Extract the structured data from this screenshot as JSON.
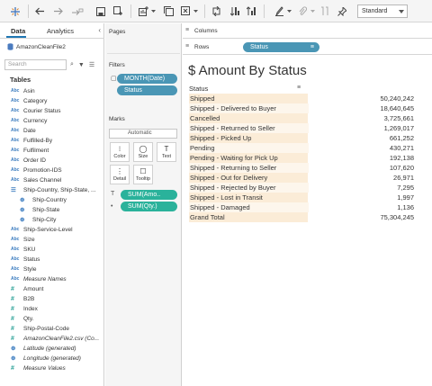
{
  "toolbar": {
    "fit_select": "Standard",
    "icons": [
      "tableau-logo-icon",
      "undo-icon",
      "redo-icon",
      "redo-dropdown-icon",
      "save-icon",
      "new-datasource-icon",
      "new-worksheet-icon",
      "new-worksheet-dropdown-icon",
      "duplicate-icon",
      "duplicate-dropdown-icon",
      "swap-icon",
      "sort-ascending-icon",
      "sort-descending-icon",
      "group-icon",
      "highlight-icon",
      "highlight-dropdown-icon",
      "clip-icon",
      "clip-dropdown-icon",
      "pin-icon"
    ]
  },
  "data_pane": {
    "tabs": [
      "Data",
      "Analytics"
    ],
    "datasource": "AmazonCleanFile2",
    "search_placeholder": "Search",
    "tables_heading": "Tables",
    "fields": [
      {
        "type": "Abc",
        "name": "Asin"
      },
      {
        "type": "Abc",
        "name": "Category"
      },
      {
        "type": "Abc",
        "name": "Courier Status"
      },
      {
        "type": "Abc",
        "name": "Currency"
      },
      {
        "type": "date",
        "name": "Date"
      },
      {
        "type": "Abc",
        "name": "Fulfilled-By"
      },
      {
        "type": "Abc",
        "name": "Fulfilment"
      },
      {
        "type": "Abc",
        "name": "Order ID"
      },
      {
        "type": "Abc",
        "name": "Promotion-IDS"
      },
      {
        "type": "Abc",
        "name": "Sales Channel"
      },
      {
        "type": "hier",
        "name": "Ship-Country, Ship-State, ..."
      },
      {
        "type": "geo",
        "name": "Ship-Country",
        "indent": true
      },
      {
        "type": "geo",
        "name": "Ship-State",
        "indent": true
      },
      {
        "type": "geo",
        "name": "Ship-City",
        "indent": true
      },
      {
        "type": "Abc",
        "name": "Ship-Service-Level"
      },
      {
        "type": "Abc",
        "name": "Size"
      },
      {
        "type": "Abc",
        "name": "SKU"
      },
      {
        "type": "Abc",
        "name": "Status"
      },
      {
        "type": "Abc",
        "name": "Style"
      },
      {
        "type": "Abc",
        "name": "Measure Names",
        "italic": true
      },
      {
        "type": "num",
        "name": "Amount"
      },
      {
        "type": "num",
        "name": "B2B"
      },
      {
        "type": "num",
        "name": "Index"
      },
      {
        "type": "num",
        "name": "Qty."
      },
      {
        "type": "num",
        "name": "Ship-Postal-Code"
      },
      {
        "type": "num",
        "name": "AmazonCleanFile2.csv (Co...",
        "italic": true
      },
      {
        "type": "geo",
        "name": "Latitude (generated)",
        "italic": true
      },
      {
        "type": "geo",
        "name": "Longitude (generated)",
        "italic": true
      },
      {
        "type": "num",
        "name": "Measure Values",
        "italic": true
      }
    ]
  },
  "shelves": {
    "pages_title": "Pages",
    "filters_title": "Filters",
    "filters": [
      "MONTH(Date)",
      "Status"
    ],
    "marks_title": "Marks",
    "marks_type": "Automatic",
    "mark_buttons": [
      "Color",
      "Size",
      "Text",
      "Detail",
      "Tooltip"
    ],
    "mark_pills": [
      "SUM(Amo..",
      "SUM(Qty.)"
    ],
    "columns_label": "Columns",
    "rows_label": "Rows",
    "rows_pill": "Status"
  },
  "view": {
    "title": "$ Amount By Status",
    "column_header": "Status",
    "rows": [
      {
        "status": "Shipped",
        "amount": "50,240,242"
      },
      {
        "status": "Shipped - Delivered to Buyer",
        "amount": "18,640,645"
      },
      {
        "status": "Cancelled",
        "amount": "3,725,661"
      },
      {
        "status": "Shipped - Returned to Seller",
        "amount": "1,269,017"
      },
      {
        "status": "Shipped - Picked Up",
        "amount": "661,252"
      },
      {
        "status": "Pending",
        "amount": "430,271"
      },
      {
        "status": "Pending - Waiting for Pick Up",
        "amount": "192,138"
      },
      {
        "status": "Shipped - Returning to Seller",
        "amount": "107,620"
      },
      {
        "status": "Shipped - Out for Delivery",
        "amount": "26,971"
      },
      {
        "status": "Shipped - Rejected by Buyer",
        "amount": "7,295"
      },
      {
        "status": "Shipped - Lost in Transit",
        "amount": "1,997"
      },
      {
        "status": "Shipped - Damaged",
        "amount": "1,136"
      },
      {
        "status": "Grand Total",
        "amount": "75,304,245"
      }
    ]
  }
}
